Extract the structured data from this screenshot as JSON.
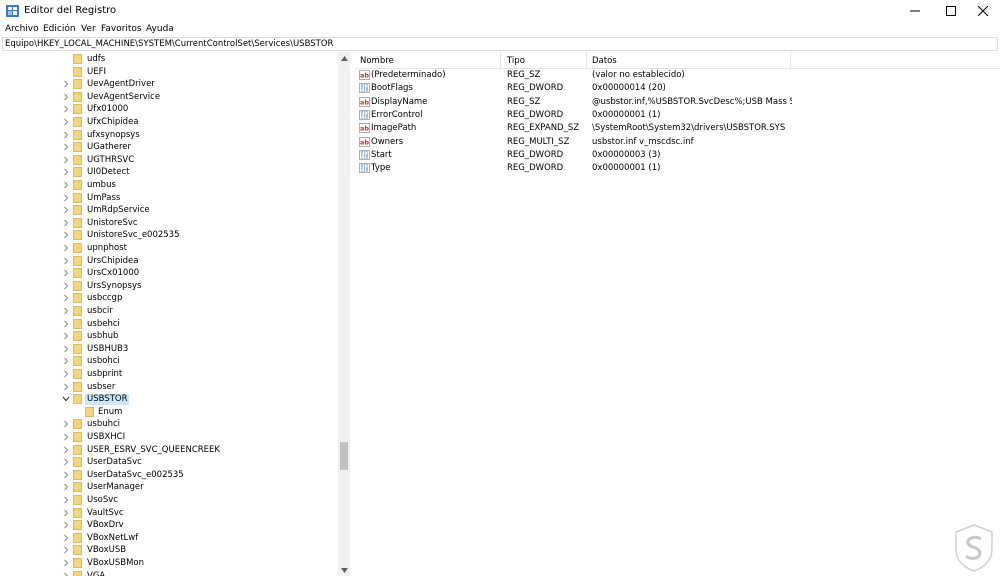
{
  "window": {
    "title": "Editor del Registro",
    "minimize_icon": "minimize-icon",
    "maximize_icon": "maximize-icon",
    "close_icon": "close-icon"
  },
  "menu": [
    "Archivo",
    "Edición",
    "Ver",
    "Favoritos",
    "Ayuda"
  ],
  "address": "Equipo\\HKEY_LOCAL_MACHINE\\SYSTEM\\CurrentControlSet\\Services\\USBSTOR",
  "tree": [
    {
      "label": "udfs",
      "expander": false
    },
    {
      "label": "UEFI",
      "expander": false
    },
    {
      "label": "UevAgentDriver",
      "expander": true
    },
    {
      "label": "UevAgentService",
      "expander": true
    },
    {
      "label": "Ufx01000",
      "expander": true
    },
    {
      "label": "UfxChipidea",
      "expander": true
    },
    {
      "label": "ufxsynopsys",
      "expander": true
    },
    {
      "label": "UGatherer",
      "expander": true
    },
    {
      "label": "UGTHRSVC",
      "expander": true
    },
    {
      "label": "UI0Detect",
      "expander": true
    },
    {
      "label": "umbus",
      "expander": true
    },
    {
      "label": "UmPass",
      "expander": true
    },
    {
      "label": "UmRdpService",
      "expander": true
    },
    {
      "label": "UnistoreSvc",
      "expander": true
    },
    {
      "label": "UnistoreSvc_e002535",
      "expander": true
    },
    {
      "label": "upnphost",
      "expander": true
    },
    {
      "label": "UrsChipidea",
      "expander": true
    },
    {
      "label": "UrsCx01000",
      "expander": true
    },
    {
      "label": "UrsSynopsys",
      "expander": true
    },
    {
      "label": "usbccgp",
      "expander": true
    },
    {
      "label": "usbcir",
      "expander": true
    },
    {
      "label": "usbehci",
      "expander": true
    },
    {
      "label": "usbhub",
      "expander": true
    },
    {
      "label": "USBHUB3",
      "expander": true
    },
    {
      "label": "usbohci",
      "expander": true
    },
    {
      "label": "usbprint",
      "expander": true
    },
    {
      "label": "usbser",
      "expander": true
    },
    {
      "label": "USBSTOR",
      "expander": "open",
      "selected": true
    },
    {
      "label": "Enum",
      "expander": false,
      "child": true
    },
    {
      "label": "usbuhci",
      "expander": true
    },
    {
      "label": "USBXHCI",
      "expander": true
    },
    {
      "label": "USER_ESRV_SVC_QUEENCREEK",
      "expander": true
    },
    {
      "label": "UserDataSvc",
      "expander": true
    },
    {
      "label": "UserDataSvc_e002535",
      "expander": true
    },
    {
      "label": "UserManager",
      "expander": true
    },
    {
      "label": "UsoSvc",
      "expander": true
    },
    {
      "label": "VaultSvc",
      "expander": true
    },
    {
      "label": "VBoxDrv",
      "expander": true
    },
    {
      "label": "VBoxNetLwf",
      "expander": true
    },
    {
      "label": "VBoxUSB",
      "expander": true
    },
    {
      "label": "VBoxUSBMon",
      "expander": true
    },
    {
      "label": "VGA",
      "expander": true
    }
  ],
  "columns": {
    "name": "Nombre",
    "type": "Tipo",
    "data": "Datos"
  },
  "values": [
    {
      "name": "(Predeterminado)",
      "type": "REG_SZ",
      "data": "(valor no establecido)",
      "icon": "string-value-icon"
    },
    {
      "name": "BootFlags",
      "type": "REG_DWORD",
      "data": "0x00000014 (20)",
      "icon": "binary-value-icon"
    },
    {
      "name": "DisplayName",
      "type": "REG_SZ",
      "data": "@usbstor.inf,%USBSTOR.SvcDesc%;USB Mass Stor...",
      "icon": "string-value-icon"
    },
    {
      "name": "ErrorControl",
      "type": "REG_DWORD",
      "data": "0x00000001 (1)",
      "icon": "binary-value-icon"
    },
    {
      "name": "ImagePath",
      "type": "REG_EXPAND_SZ",
      "data": "\\SystemRoot\\System32\\drivers\\USBSTOR.SYS",
      "icon": "string-value-icon"
    },
    {
      "name": "Owners",
      "type": "REG_MULTI_SZ",
      "data": "usbstor.inf v_mscdsc.inf",
      "icon": "string-value-icon"
    },
    {
      "name": "Start",
      "type": "REG_DWORD",
      "data": "0x00000003 (3)",
      "icon": "binary-value-icon"
    },
    {
      "name": "Type",
      "type": "REG_DWORD",
      "data": "0x00000001 (1)",
      "icon": "binary-value-icon"
    }
  ],
  "colors": {
    "folder": "#f5d47a",
    "selection": "#cce8ff",
    "string_icon": "#c0392b",
    "binary_icon": "#2a63b8"
  }
}
